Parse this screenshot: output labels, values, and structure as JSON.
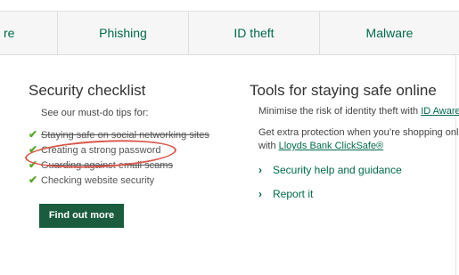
{
  "tabs": [
    {
      "label": "re"
    },
    {
      "label": "Phishing"
    },
    {
      "label": "ID theft"
    },
    {
      "label": "Malware"
    }
  ],
  "checklist": {
    "title": "Security checklist",
    "intro": "See our must-do tips for:",
    "items": [
      {
        "label": "Staying safe on social networking sites"
      },
      {
        "label": "Creating a strong password"
      },
      {
        "label": "Guarding against email scams"
      },
      {
        "label": "Checking website security"
      }
    ],
    "button_label": "Find out more"
  },
  "tools": {
    "title": "Tools for staying safe online",
    "line1_text": "Minimise the risk of identity theft with ",
    "line1_link": "ID Aware",
    "line2_text": "Get extra protection when you’re shopping online",
    "line3_prefix": "with ",
    "line3_link": "Lloyds Bank ClickSafe®",
    "links": [
      {
        "label": "Security help and guidance"
      },
      {
        "label": "Report it"
      }
    ]
  },
  "colors": {
    "brand_green": "#006a4d",
    "button_green": "#1a5c3d",
    "check_green": "#5aa72a",
    "annotation_red": "#d9574a"
  },
  "icons": {
    "check": "checkmark-icon",
    "chevron": "chevron-right-icon"
  }
}
